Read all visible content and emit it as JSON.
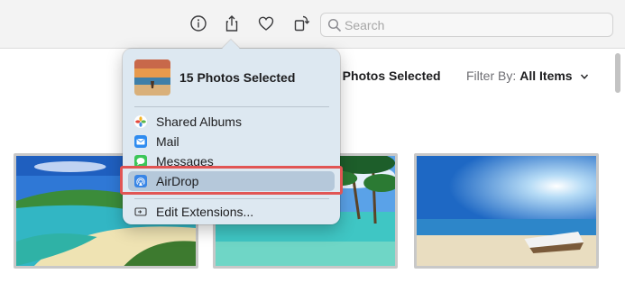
{
  "toolbar": {
    "info_icon": "info-icon",
    "share_icon": "share-icon",
    "favorite_icon": "heart-icon",
    "rotate_icon": "rotate-icon",
    "search_placeholder": "Search"
  },
  "header": {
    "selection_title": "5 Photos Selected",
    "filter_label": "Filter By:",
    "filter_value": "All Items"
  },
  "share_menu": {
    "title": "15 Photos Selected",
    "items": [
      {
        "label": "Shared Albums",
        "icon": "shared-albums-icon"
      },
      {
        "label": "Mail",
        "icon": "mail-icon"
      },
      {
        "label": "Messages",
        "icon": "messages-icon"
      },
      {
        "label": "AirDrop",
        "icon": "airdrop-icon",
        "selected": true
      },
      {
        "label": "Edit Extensions...",
        "icon": "extensions-icon"
      }
    ]
  },
  "colors": {
    "highlight": "#e15554",
    "popover_bg": "#dde8f1",
    "selected_item_bg": "#b5c8da"
  }
}
